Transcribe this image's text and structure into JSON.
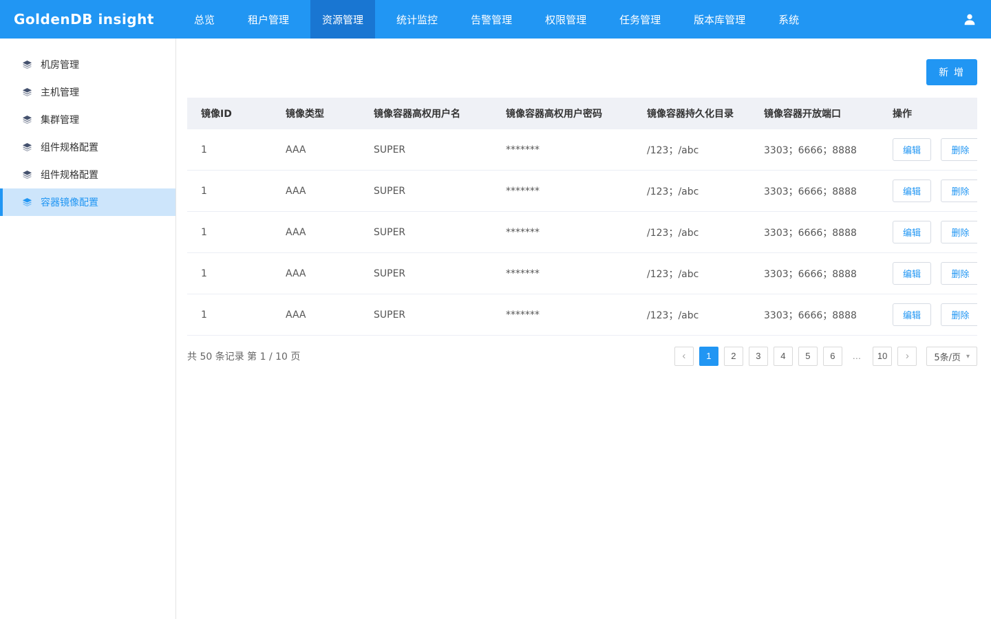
{
  "app": {
    "brand": "GoldenDB insight"
  },
  "nav": {
    "items": [
      {
        "label": "总览"
      },
      {
        "label": "租户管理"
      },
      {
        "label": "资源管理"
      },
      {
        "label": "统计监控"
      },
      {
        "label": "告警管理"
      },
      {
        "label": "权限管理"
      },
      {
        "label": "任务管理"
      },
      {
        "label": "版本库管理"
      },
      {
        "label": "系统"
      }
    ],
    "active": "资源管理"
  },
  "sidebar": {
    "items": [
      {
        "label": "机房管理"
      },
      {
        "label": "主机管理"
      },
      {
        "label": "集群管理"
      },
      {
        "label": "组件规格配置"
      },
      {
        "label": "组件规格配置"
      },
      {
        "label": "容器镜像配置"
      }
    ],
    "active": "容器镜像配置"
  },
  "toolbar": {
    "add_label": "新 增"
  },
  "table": {
    "headers": [
      "镜像ID",
      "镜像类型",
      "镜像容器高权用户名",
      "镜像容器高权用户密码",
      "镜像容器持久化目录",
      "镜像容器开放端口",
      "操作"
    ],
    "rows": [
      {
        "image_id": "1",
        "image_type": "AAA",
        "username": "SUPER",
        "password": "*******",
        "persist_dir": "/123；/abc",
        "ports": "3303；6666；8888"
      },
      {
        "image_id": "1",
        "image_type": "AAA",
        "username": "SUPER",
        "password": "*******",
        "persist_dir": "/123；/abc",
        "ports": "3303；6666；8888"
      },
      {
        "image_id": "1",
        "image_type": "AAA",
        "username": "SUPER",
        "password": "*******",
        "persist_dir": "/123；/abc",
        "ports": "3303；6666；8888"
      },
      {
        "image_id": "1",
        "image_type": "AAA",
        "username": "SUPER",
        "password": "*******",
        "persist_dir": "/123；/abc",
        "ports": "3303；6666；8888"
      },
      {
        "image_id": "1",
        "image_type": "AAA",
        "username": "SUPER",
        "password": "*******",
        "persist_dir": "/123；/abc",
        "ports": "3303；6666；8888"
      }
    ],
    "actions": {
      "edit": "编辑",
      "delete": "删除"
    }
  },
  "pagination": {
    "summary": "共 50 条记录 第 1 / 10 页",
    "prev": "‹",
    "next": "›",
    "pages": [
      "1",
      "2",
      "3",
      "4",
      "5",
      "6",
      "…",
      "10"
    ],
    "active_page": "1",
    "page_size": "5条/页"
  },
  "colors": {
    "brand_blue": "#2196f3",
    "nav_active_blue": "#1976d2",
    "sidebar_active_bg": "#cde5fb",
    "table_header_bg": "#eff1f6"
  }
}
